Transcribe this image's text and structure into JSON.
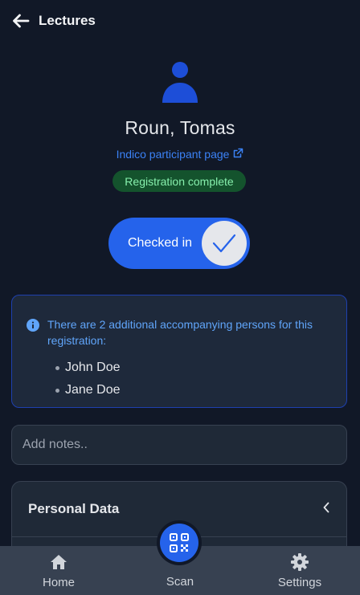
{
  "header": {
    "title": "Lectures"
  },
  "participant": {
    "name": "Roun, Tomas",
    "indico_link": "Indico participant page",
    "registration_status": "Registration complete"
  },
  "checkin": {
    "label": "Checked in",
    "checked": true
  },
  "accompanying": {
    "message": "There are 2 additional accompanying persons for this registration:",
    "persons": [
      "John Doe",
      "Jane Doe"
    ]
  },
  "notes": {
    "placeholder": "Add notes..",
    "value": ""
  },
  "personal_data": {
    "title": "Personal Data"
  },
  "nav": {
    "home": "Home",
    "scan": "Scan",
    "settings": "Settings"
  },
  "colors": {
    "background": "#111827",
    "accent": "#2563eb",
    "link": "#3b82f6",
    "badge_bg": "#14532d",
    "badge_text": "#86efac"
  },
  "icons": {
    "back": "arrow-left-icon",
    "avatar": "user-icon",
    "external": "external-link-icon",
    "check": "check-icon",
    "info": "info-icon",
    "chevron": "chevron-left-icon",
    "home": "home-icon",
    "scan": "qr-code-icon",
    "settings": "gear-icon"
  }
}
